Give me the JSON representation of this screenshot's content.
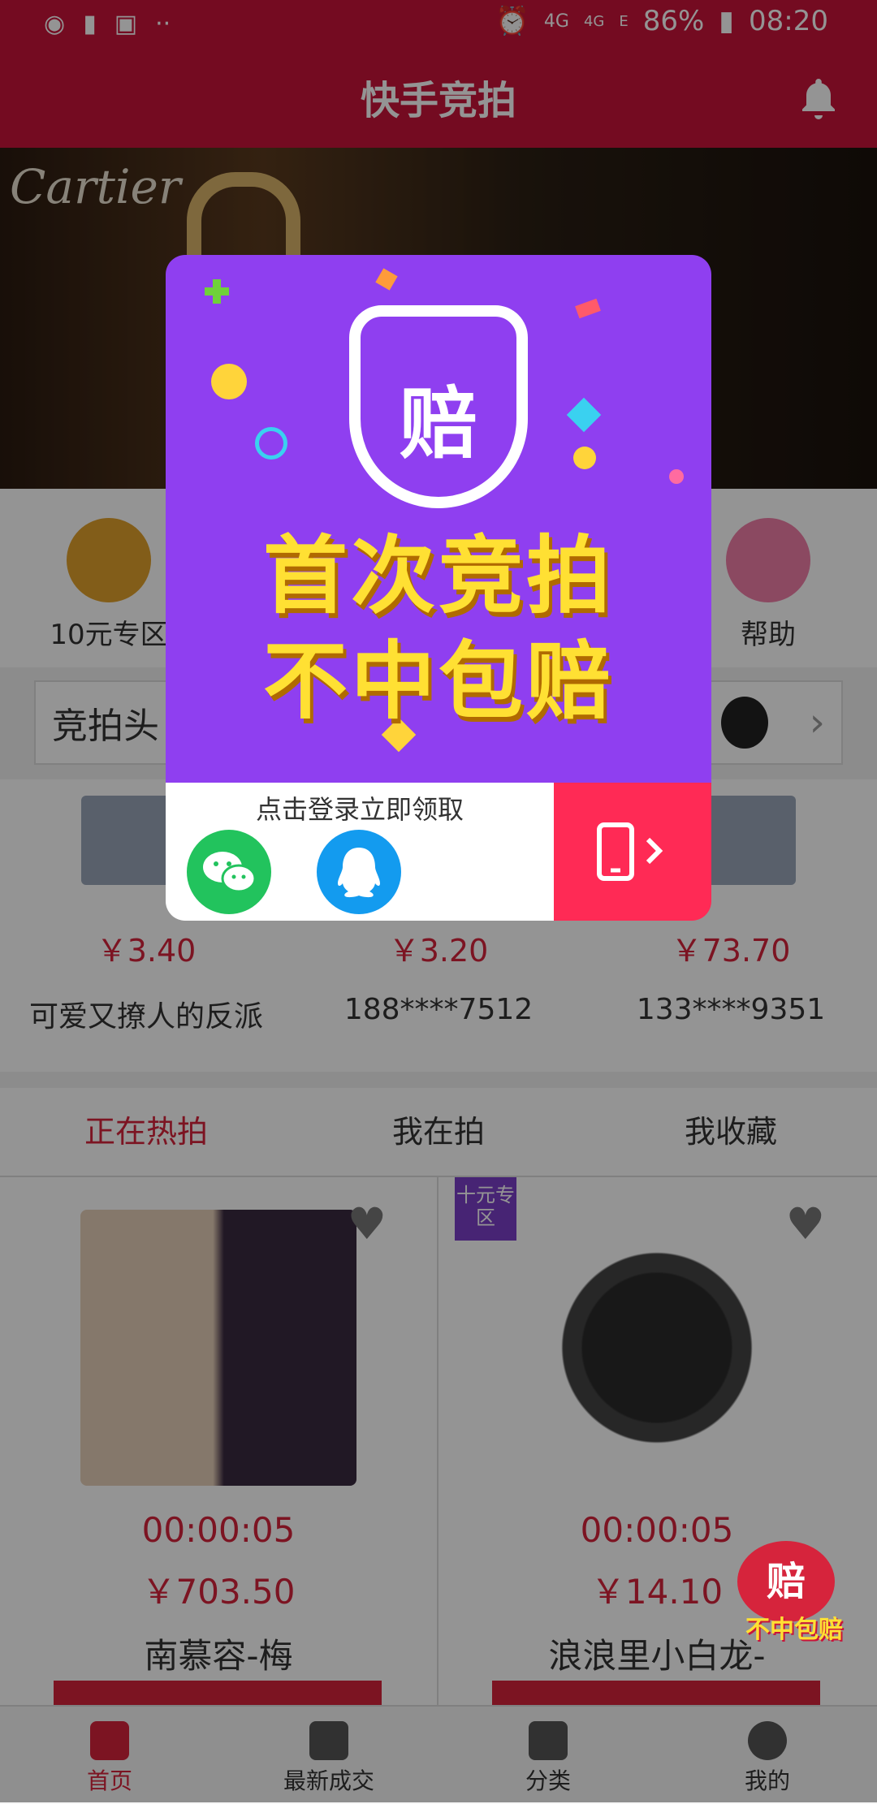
{
  "status_bar": {
    "battery": "86%",
    "time": "08:20",
    "net1": "4G",
    "net2": "4G",
    "net3": "E"
  },
  "header": {
    "title": "快手竞拍"
  },
  "banner": {
    "brand": "Cartier"
  },
  "categories": [
    {
      "label": "10元专区",
      "color": "#e0a02c",
      "icon": "price-tag-icon"
    },
    {
      "label": "帮助",
      "color": "#ef7fa8",
      "icon": "help-book-icon"
    }
  ],
  "news": {
    "title": "竞拍头"
  },
  "deals": [
    {
      "price": "￥3.40",
      "user": "可爱又撩人的反派"
    },
    {
      "price": "￥3.20",
      "user": "188****7512"
    },
    {
      "price": "￥73.70",
      "user": "133****9351"
    }
  ],
  "tabs": [
    {
      "label": "正在热拍"
    },
    {
      "label": "我在拍"
    },
    {
      "label": "我收藏"
    }
  ],
  "products": [
    {
      "timer": "00:00:05",
      "price": "￥703.50",
      "name": "南慕容-梅"
    },
    {
      "timer": "00:00:05",
      "price": "￥14.10",
      "name": "浪浪里小白龙-",
      "ribbon": "十元专区"
    }
  ],
  "nav": [
    {
      "label": "首页",
      "icon": "home-icon"
    },
    {
      "label": "最新成交",
      "icon": "gavel-icon"
    },
    {
      "label": "分类",
      "icon": "category-search-icon"
    },
    {
      "label": "我的",
      "icon": "user-icon"
    }
  ],
  "modal": {
    "shield_char": "赔",
    "line1": "首次竞拍",
    "line2": "不中包赔",
    "login_prompt": "点击登录立即领取"
  },
  "float_badge": {
    "char": "赔",
    "text": "不中包赔"
  },
  "colors": {
    "brand_red": "#c8143a",
    "price_red": "#d6243c",
    "promo_purple": "#8f3ff0",
    "promo_yellow": "#ffe033",
    "phone_btn": "#ff2a55"
  }
}
